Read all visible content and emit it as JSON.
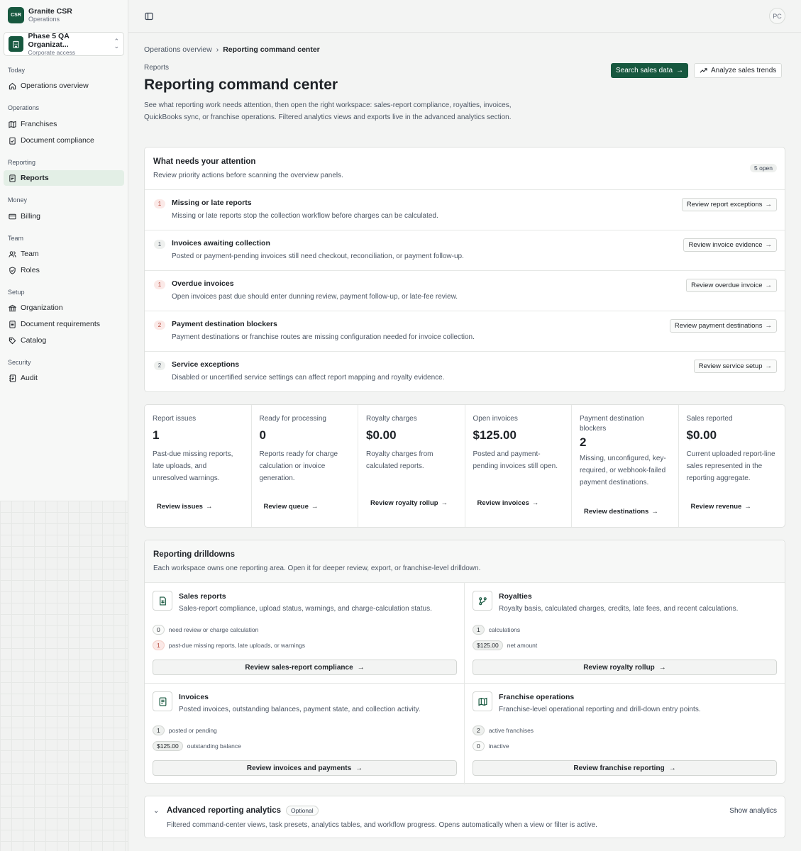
{
  "brand": {
    "logo": "CSR",
    "name": "Granite CSR",
    "sub": "Operations"
  },
  "org": {
    "name": "Phase 5 QA Organizat...",
    "sub": "Corporate access"
  },
  "nav": {
    "groups": [
      "Today",
      "Operations",
      "Reporting",
      "Money",
      "Team",
      "Setup",
      "Security"
    ],
    "items": [
      "Operations overview",
      "Franchises",
      "Document compliance",
      "Reports",
      "Billing",
      "Team",
      "Roles",
      "Organization",
      "Document requirements",
      "Catalog",
      "Audit"
    ]
  },
  "topbar": {
    "avatar": "PC"
  },
  "breadcrumb": {
    "parent": "Operations overview",
    "separator": "›",
    "current": "Reporting command center"
  },
  "header": {
    "eyebrow": "Reports",
    "title": "Reporting command center",
    "intro": "See what reporting work needs attention, then open the right workspace: sales-report compliance, royalties, invoices, QuickBooks sync, or franchise operations. Filtered analytics views and exports live in the advanced analytics section.",
    "primary_button": "Search sales data",
    "secondary_button": "Analyze sales trends"
  },
  "attention": {
    "title": "What needs your attention",
    "subtitle": "Review priority actions before scanning the overview panels.",
    "count": "5 open",
    "rows": [
      {
        "badge": "1",
        "tone": "red",
        "title": "Missing or late reports",
        "desc": "Missing or late reports stop the collection workflow before charges can be calculated.",
        "action": "Review report exceptions"
      },
      {
        "badge": "1",
        "tone": "gray",
        "title": "Invoices awaiting collection",
        "desc": "Posted or payment-pending invoices still need checkout, reconciliation, or payment follow-up.",
        "action": "Review invoice evidence"
      },
      {
        "badge": "1",
        "tone": "red",
        "title": "Overdue invoices",
        "desc": "Open invoices past due should enter dunning review, payment follow-up, or late-fee review.",
        "action": "Review overdue invoice"
      },
      {
        "badge": "2",
        "tone": "red",
        "title": "Payment destination blockers",
        "desc": "Payment destinations or franchise routes are missing configuration needed for invoice collection.",
        "action": "Review payment destinations"
      },
      {
        "badge": "2",
        "tone": "gray",
        "title": "Service exceptions",
        "desc": "Disabled or uncertified service settings can affect report mapping and royalty evidence.",
        "action": "Review service setup"
      }
    ]
  },
  "metrics": [
    {
      "label": "Report issues",
      "value": "1",
      "desc": "Past-due missing reports, late uploads, and unresolved warnings.",
      "link": "Review issues"
    },
    {
      "label": "Ready for processing",
      "value": "0",
      "desc": "Reports ready for charge calculation or invoice generation.",
      "link": "Review queue"
    },
    {
      "label": "Royalty charges",
      "value": "$0.00",
      "desc": "Royalty charges from calculated reports.",
      "link": "Review royalty rollup"
    },
    {
      "label": "Open invoices",
      "value": "$125.00",
      "desc": "Posted and payment-pending invoices still open.",
      "link": "Review invoices"
    },
    {
      "label": "Payment destination blockers",
      "value": "2",
      "desc": "Missing, unconfigured, key-required, or webhook-failed payment destinations.",
      "link": "Review destinations"
    },
    {
      "label": "Sales reported",
      "value": "$0.00",
      "desc": "Current uploaded report-line sales represented in the reporting aggregate.",
      "link": "Review revenue"
    }
  ],
  "drilldowns": {
    "title": "Reporting drilldowns",
    "subtitle": "Each workspace owns one reporting area. Open it for deeper review, export, or franchise-level drilldown.",
    "cells": [
      {
        "icon": "sales-report-icon",
        "title": "Sales reports",
        "desc": "Sales-report compliance, upload status, warnings, and charge-calculation status.",
        "stats": [
          {
            "value": "0",
            "tone": "plain",
            "label": "need review or charge calculation"
          },
          {
            "value": "1",
            "tone": "red",
            "label": "past-due missing reports, late uploads, or warnings"
          }
        ],
        "action": "Review sales-report compliance"
      },
      {
        "icon": "royalties-icon",
        "title": "Royalties",
        "desc": "Royalty basis, calculated charges, credits, late fees, and recent calculations.",
        "stats": [
          {
            "value": "1",
            "tone": "gray",
            "label": "calculations"
          },
          {
            "value": "$125.00",
            "tone": "gray",
            "label": "net amount"
          }
        ],
        "action": "Review royalty rollup"
      },
      {
        "icon": "invoice-icon",
        "title": "Invoices",
        "desc": "Posted invoices, outstanding balances, payment state, and collection activity.",
        "stats": [
          {
            "value": "1",
            "tone": "gray",
            "label": "posted or pending"
          },
          {
            "value": "$125.00",
            "tone": "gray",
            "label": "outstanding balance"
          }
        ],
        "action": "Review invoices and payments"
      },
      {
        "icon": "map-icon",
        "title": "Franchise operations",
        "desc": "Franchise-level operational reporting and drill-down entry points.",
        "stats": [
          {
            "value": "2",
            "tone": "gray",
            "label": "active franchises"
          },
          {
            "value": "0",
            "tone": "plain",
            "label": "inactive"
          }
        ],
        "action": "Review franchise reporting"
      }
    ]
  },
  "advanced": {
    "title": "Advanced reporting analytics",
    "badge": "Optional",
    "toggle": "Show analytics",
    "desc": "Filtered command-center views, task presets, analytics tables, and workflow progress. Opens automatically when a view or filter is active."
  },
  "colors": {
    "brand": "#17583f",
    "active_nav": "#e3efe6",
    "danger": "#b4463a"
  }
}
